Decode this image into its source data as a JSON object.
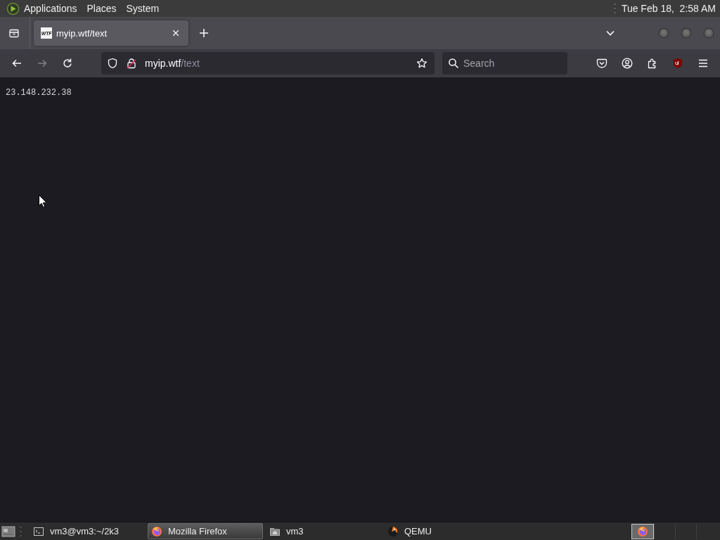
{
  "top_panel": {
    "menus": [
      "Applications",
      "Places",
      "System"
    ],
    "clock": "Tue Feb 18,  2:58 AM"
  },
  "tab_strip": {
    "tabs": [
      {
        "title": "myip.wtf/text",
        "favicon_text": "WTF",
        "selected": true
      }
    ]
  },
  "navigation": {
    "back_enabled": true,
    "forward_enabled": false,
    "address": {
      "host": "myip.wtf",
      "path": "/text"
    },
    "search": {
      "placeholder": "Search"
    }
  },
  "page": {
    "text": "23.148.232.38"
  },
  "taskbar": {
    "windows": [
      {
        "title": "vm3@vm3:~/2k3",
        "kind": "terminal",
        "selected": false
      },
      {
        "title": "Mozilla Firefox",
        "kind": "firefox",
        "selected": true
      },
      {
        "title": "vm3",
        "kind": "folder",
        "selected": false
      },
      {
        "title": "QEMU",
        "kind": "qemu",
        "selected": false
      }
    ],
    "workspaces": [
      {
        "selected": true,
        "kind": "firefox"
      },
      {
        "selected": false,
        "kind": "empty"
      },
      {
        "selected": false,
        "kind": "empty"
      },
      {
        "selected": false,
        "kind": "empty"
      }
    ]
  }
}
